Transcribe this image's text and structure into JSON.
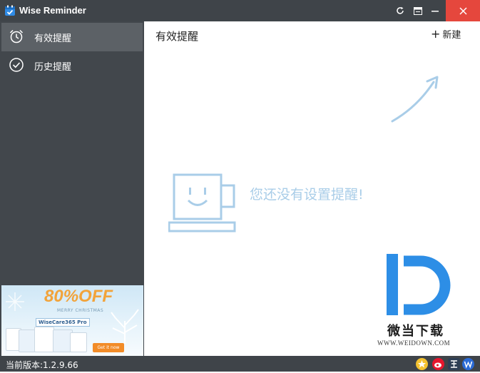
{
  "window": {
    "title": "Wise Reminder"
  },
  "sidebar": {
    "items": [
      {
        "label": "有效提醒",
        "icon": "alarm-clock-icon",
        "active": true
      },
      {
        "label": "历史提醒",
        "icon": "check-circle-icon",
        "active": false
      }
    ],
    "promo": {
      "discount": "80%OFF",
      "subtitle": "MERRY CHRISTMAS",
      "product": "WiseCare365 Pro",
      "cta": "Get it now"
    }
  },
  "main": {
    "title": "有效提醒",
    "new_button": "新建",
    "empty_message": "您还没有设置提醒!"
  },
  "watermark": {
    "name": "微当下载",
    "url": "WWW.WEIDOWN.COM"
  },
  "status": {
    "version": "当前版本:1.2.9.66"
  },
  "colors": {
    "titlebar": "#3f4449",
    "sidebar": "#42474c",
    "close": "#e5473d",
    "accent": "#a9cde8"
  }
}
